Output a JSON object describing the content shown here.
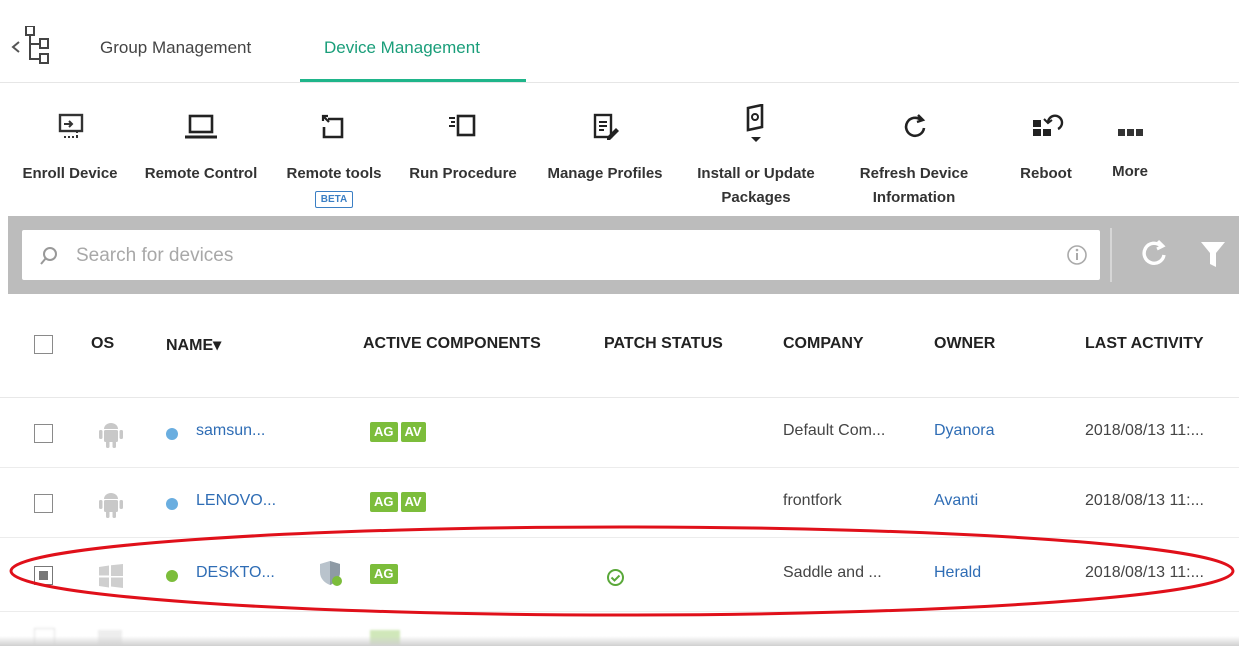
{
  "tabs": {
    "group": "Group Management",
    "device": "Device Management"
  },
  "toolbar": {
    "enroll": "Enroll Device",
    "remote_control": "Remote Control",
    "remote_tools": "Remote tools",
    "beta": "BETA",
    "run_procedure": "Run Procedure",
    "manage_profiles": "Manage Profiles",
    "install_line1": "Install or Update",
    "install_line2": "Packages",
    "refresh_line1": "Refresh Device",
    "refresh_line2": "Information",
    "reboot": "Reboot",
    "more": "More"
  },
  "search": {
    "placeholder": "Search for devices"
  },
  "table": {
    "headers": {
      "os": "OS",
      "name": "NAME",
      "sort_arrow": "▾",
      "active_components": "ACTIVE COMPONENTS",
      "patch_status": "PATCH STATUS",
      "company": "COMPANY",
      "owner": "OWNER",
      "last_activity": "LAST ACTIVITY"
    },
    "rows": [
      {
        "os": "android",
        "status_color": "#6aaee0",
        "name": "samsun...",
        "components": [
          "AG",
          "AV"
        ],
        "company": "Default Com...",
        "owner": "Dyanora",
        "last_activity": "2018/08/13 11:..."
      },
      {
        "os": "android",
        "status_color": "#6aaee0",
        "name": "LENOVO...",
        "components": [
          "AG",
          "AV"
        ],
        "company": "frontfork",
        "owner": "Avanti",
        "last_activity": "2018/08/13 11:..."
      },
      {
        "os": "windows",
        "status_color": "#7cbd3b",
        "name": "DESKTO...",
        "components": [
          "AG"
        ],
        "patch_ok": true,
        "company": "Saddle and ...",
        "owner": "Herald",
        "last_activity": "2018/08/13 11:..."
      }
    ]
  },
  "colors": {
    "accent": "#1fb58a",
    "link": "#2f6db5",
    "badge": "#7cbd3b",
    "highlight": "#e0101a"
  }
}
